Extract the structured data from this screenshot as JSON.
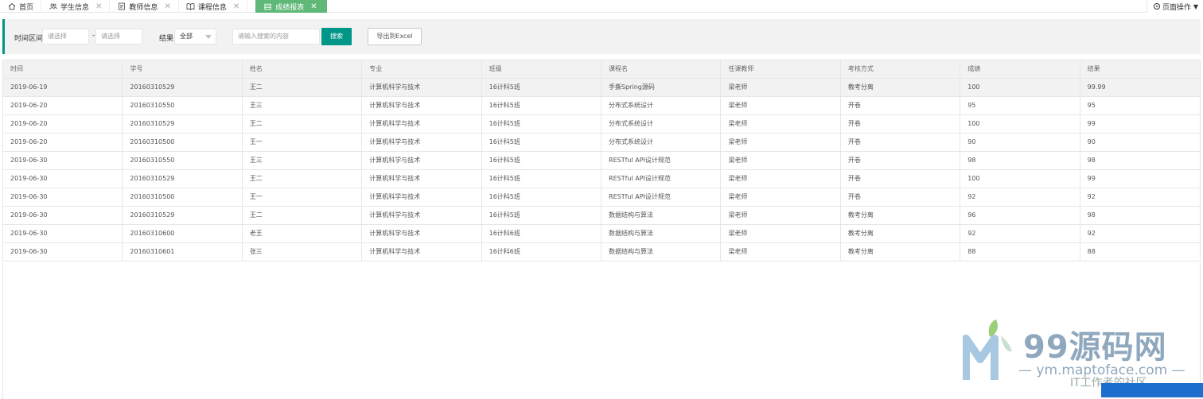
{
  "tabs": [
    {
      "label": "首页",
      "icon": "home-icon",
      "closable": false
    },
    {
      "label": "学生信息",
      "icon": "users-icon",
      "closable": true
    },
    {
      "label": "教师信息",
      "icon": "id-card-icon",
      "closable": true
    },
    {
      "label": "课程信息",
      "icon": "book-icon",
      "closable": true
    },
    {
      "label": "成绩报表",
      "icon": "table-icon",
      "closable": true,
      "active": true
    }
  ],
  "page_ops": {
    "label": "页面操作"
  },
  "filter": {
    "time_label": "时间区间",
    "start_placeholder": "请选择",
    "end_placeholder": "请选择",
    "separator": "-",
    "result_label": "结果",
    "result_selected": "全部",
    "search_placeholder": "请输入搜索的内容",
    "search_button": "搜索",
    "export_button": "导出到Excel"
  },
  "table": {
    "headers": [
      "时间",
      "学号",
      "姓名",
      "专业",
      "班级",
      "课程名",
      "任课教师",
      "考核方式",
      "成绩",
      "结果"
    ],
    "rows": [
      [
        "2019-06-19",
        "20160310529",
        "王二",
        "计算机科学与技术",
        "16计科5班",
        "手撕Spring源码",
        "梁老师",
        "教考分离",
        "100",
        "99.99"
      ],
      [
        "2019-06-20",
        "20160310550",
        "王三",
        "计算机科学与技术",
        "16计科5班",
        "分布式系统设计",
        "梁老师",
        "开卷",
        "95",
        "95"
      ],
      [
        "2019-06-20",
        "20160310529",
        "王二",
        "计算机科学与技术",
        "16计科5班",
        "分布式系统设计",
        "梁老师",
        "开卷",
        "100",
        "99"
      ],
      [
        "2019-06-20",
        "20160310500",
        "王一",
        "计算机科学与技术",
        "16计科5班",
        "分布式系统设计",
        "梁老师",
        "开卷",
        "90",
        "90"
      ],
      [
        "2019-06-30",
        "20160310550",
        "王三",
        "计算机科学与技术",
        "16计科5班",
        "RESTful API设计规范",
        "梁老师",
        "开卷",
        "98",
        "98"
      ],
      [
        "2019-06-30",
        "20160310529",
        "王二",
        "计算机科学与技术",
        "16计科5班",
        "RESTful API设计规范",
        "梁老师",
        "开卷",
        "100",
        "99"
      ],
      [
        "2019-06-30",
        "20160310500",
        "王一",
        "计算机科学与技术",
        "16计科5班",
        "RESTful API设计规范",
        "梁老师",
        "开卷",
        "92",
        "92"
      ],
      [
        "2019-06-30",
        "20160310529",
        "王二",
        "计算机科学与技术",
        "16计科5班",
        "数据结构与算法",
        "梁老师",
        "教考分离",
        "96",
        "98"
      ],
      [
        "2019-06-30",
        "20160310600",
        "老王",
        "计算机科学与技术",
        "16计科6班",
        "数据结构与算法",
        "梁老师",
        "教考分离",
        "92",
        "92"
      ],
      [
        "2019-06-30",
        "20160310601",
        "张三",
        "计算机科学与技术",
        "16计科6班",
        "数据结构与算法",
        "梁老师",
        "教考分离",
        "88",
        "88"
      ]
    ]
  },
  "watermark": {
    "title": "99源码网",
    "url": "— ym.maptoface.com —",
    "sub": "IT工作者的社区"
  },
  "colors": {
    "accent": "#009688",
    "active_tab": "#5fb878",
    "panel": "#f2f2f2",
    "border": "#e6e6e6"
  }
}
